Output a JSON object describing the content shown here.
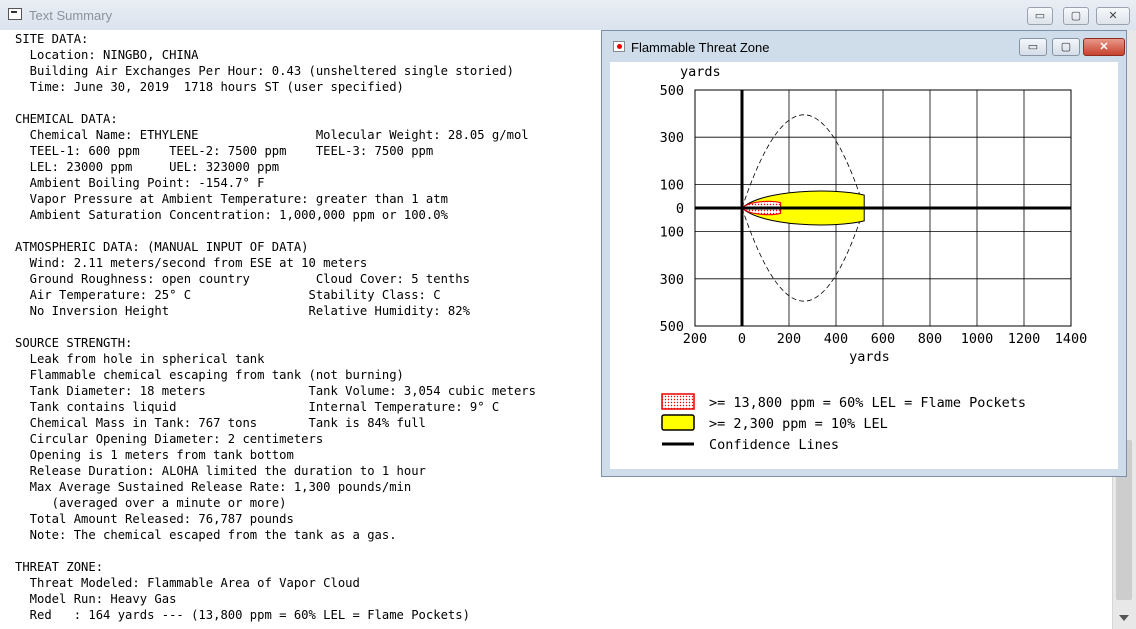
{
  "main_window": {
    "title": "Text Summary",
    "minimize_glyph": "▭",
    "maximize_glyph": "▢",
    "close_glyph": "✕",
    "summary_lines": [
      "SITE DATA:",
      "  Location: NINGBO, CHINA",
      "  Building Air Exchanges Per Hour: 0.43 (unsheltered single storied)",
      "  Time: June 30, 2019  1718 hours ST (user specified)",
      "",
      "CHEMICAL DATA:",
      "  Chemical Name: ETHYLENE                Molecular Weight: 28.05 g/mol",
      "  TEEL-1: 600 ppm    TEEL-2: 7500 ppm    TEEL-3: 7500 ppm",
      "  LEL: 23000 ppm     UEL: 323000 ppm",
      "  Ambient Boiling Point: -154.7° F",
      "  Vapor Pressure at Ambient Temperature: greater than 1 atm",
      "  Ambient Saturation Concentration: 1,000,000 ppm or 100.0%",
      "",
      "ATMOSPHERIC DATA: (MANUAL INPUT OF DATA)",
      "  Wind: 2.11 meters/second from ESE at 10 meters",
      "  Ground Roughness: open country         Cloud Cover: 5 tenths",
      "  Air Temperature: 25° C                Stability Class: C",
      "  No Inversion Height                   Relative Humidity: 82%",
      "",
      "SOURCE STRENGTH:",
      "  Leak from hole in spherical tank",
      "  Flammable chemical escaping from tank (not burning)",
      "  Tank Diameter: 18 meters              Tank Volume: 3,054 cubic meters",
      "  Tank contains liquid                  Internal Temperature: 9° C",
      "  Chemical Mass in Tank: 767 tons       Tank is 84% full",
      "  Circular Opening Diameter: 2 centimeters",
      "  Opening is 1 meters from tank bottom",
      "  Release Duration: ALOHA limited the duration to 1 hour",
      "  Max Average Sustained Release Rate: 1,300 pounds/min",
      "     (averaged over a minute or more)",
      "  Total Amount Released: 76,787 pounds",
      "  Note: The chemical escaped from the tank as a gas.",
      "",
      "THREAT ZONE:",
      "  Threat Modeled: Flammable Area of Vapor Cloud",
      "  Model Run: Heavy Gas",
      "  Red   : 164 yards --- (13,800 ppm = 60% LEL = Flame Pockets)"
    ]
  },
  "threat_window": {
    "title": "Flammable Threat Zone",
    "minimize_glyph": "▭",
    "maximize_glyph": "▢",
    "close_glyph": "✕",
    "legend": [
      {
        "label": ">= 13,800 ppm = 60% LEL = Flame Pockets",
        "color": "#ff0000"
      },
      {
        "label": ">= 2,300 ppm = 10% LEL",
        "color": "#ffff00"
      },
      {
        "label": "Confidence Lines",
        "color": "#000000"
      }
    ]
  },
  "chart_data": {
    "type": "area",
    "xlabel": "yards",
    "ylabel": "yards",
    "x_ticks": [
      "200",
      "0",
      "200",
      "400",
      "600",
      "800",
      "1000",
      "1200",
      "1400"
    ],
    "y_ticks": [
      "500",
      "300",
      "100",
      "0",
      "100",
      "300",
      "500"
    ],
    "xlim": [
      -200,
      1400
    ],
    "ylim": [
      -500,
      500
    ],
    "grid": true,
    "zones": [
      {
        "name": ">= 13,800 ppm = 60% LEL = Flame Pockets",
        "color": "#ff0000",
        "max_x": 164,
        "half_width": 32
      },
      {
        "name": ">= 2,300 ppm = 10% LEL",
        "color": "#ffff00",
        "max_x": 520,
        "half_width": 78
      }
    ],
    "confidence_lines": {
      "max_x": 520,
      "half_width": 400,
      "peak_x": 300
    }
  }
}
